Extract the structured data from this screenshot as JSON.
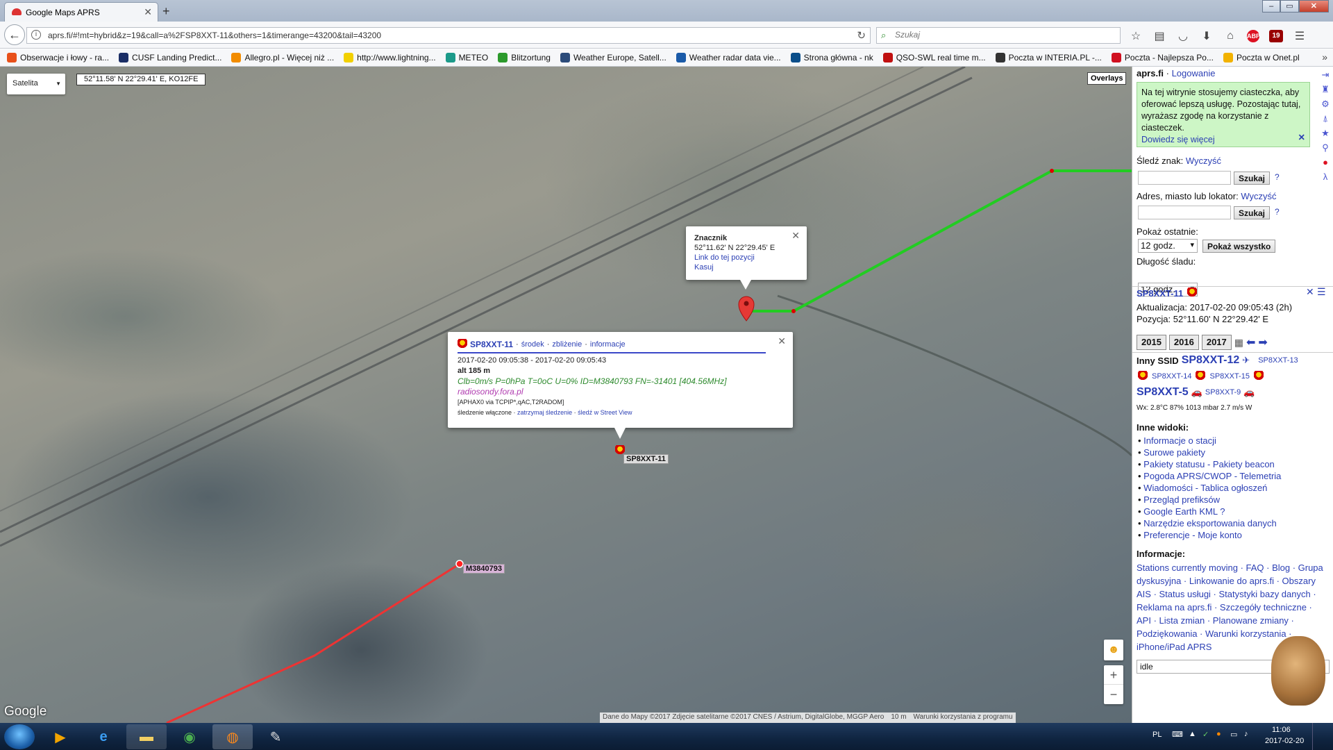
{
  "browser": {
    "tab_title": "Google Maps APRS",
    "url": "aprs.fi/#!mt=hybrid&z=19&call=a%2FSP8XXT-11&others=1&timerange=43200&tail=43200",
    "search_placeholder": "Szukaj",
    "toolbar_badge": "19",
    "abp_label": "ABP",
    "bookmarks": [
      {
        "label": "Obserwacje i łowy - ra...",
        "color": "#e8501a"
      },
      {
        "label": "CUSF Landing Predict...",
        "color": "#1a2e66"
      },
      {
        "label": "Allegro.pl - Więcej niż ...",
        "color": "#f28c00"
      },
      {
        "label": "http://www.lightning...",
        "color": "#f2d000"
      },
      {
        "label": "METEO",
        "color": "#1c9a8a"
      },
      {
        "label": "Blitzortung",
        "color": "#2c9a2c"
      },
      {
        "label": "Weather Europe, Satell...",
        "color": "#2b4b7a"
      },
      {
        "label": "Weather radar data vie...",
        "color": "#1a5aa8"
      },
      {
        "label": "Strona główna - nk",
        "color": "#0a4e8a"
      },
      {
        "label": "QSO-SWL real time m...",
        "color": "#c01010"
      },
      {
        "label": "Poczta w INTERIA.PL -...",
        "color": "#333333"
      },
      {
        "label": "Poczta - Najlepsza Po...",
        "color": "#d01020"
      },
      {
        "label": "Poczta w Onet.pl",
        "color": "#f2b200"
      }
    ]
  },
  "map": {
    "type_label": "Satelita",
    "cursor_coords": "52°11.58' N 22°29.41' E, KO12FE",
    "overlays_label": "Overlays",
    "google_logo": "Google",
    "attribution": "Dane do Mapy ©2017 Zdjęcie satelitarne ©2017 CNES / Astrium, DigitalGlobe, MGGP Aero",
    "scale": "10 m",
    "terms": "Warunki korzystania z programu",
    "labels": {
      "station": "SP8XXT-11",
      "sonde": "M3840793"
    },
    "marker_popup": {
      "title": "Znacznik",
      "coords": "52°11.62' N 22°29.45' E",
      "link": "Link do tej pozycji",
      "delete": "Kasuj"
    },
    "station_popup": {
      "callsign": "SP8XXT-11",
      "sep1": " · ",
      "center": "środek",
      "sep2": " · ",
      "zoom": "zbliżenie",
      "sep3": " · ",
      "info": "informacje",
      "time_range": "2017-02-20 09:05:38 - 2017-02-20 09:05:43",
      "altitude": "alt 185 m",
      "comment": "Clb=0m/s P=0hPa T=0oC U=0% ID=M3840793 FN=-31401 [404.56MHz]",
      "website": "radiosondy.fora.pl",
      "path": "[APHAX0 via TCPIP*,qAC,T2RADOM]",
      "tracking": "śledzenie włączone",
      "sep4": " · ",
      "stop_tracking": "zatrzymaj śledzenie",
      "sep5": " · ",
      "street_view": "śledź w Street View"
    }
  },
  "panel": {
    "site": "aprs.fi",
    "sep": " · ",
    "login": "Logowanie",
    "cookie_text": "Na tej witrynie stosujemy ciasteczka, aby oferować lepszą usługę. Pozostając tutaj, wyrażasz zgodę na korzystanie z ciasteczek.",
    "cookie_link": "Dowiedz się więcej",
    "track_label": "Śledź znak:",
    "clear": "Wyczyść",
    "address_label": "Adres, miasto lub lokator:",
    "search_btn": "Szukaj",
    "help": "?",
    "show_last_label": "Pokaż ostatnie:",
    "show_last_value": "12 godz.",
    "show_all_btn": "Pokaż wszystko",
    "trail_label": "Długość śladu:",
    "trail_value": "12 godz.",
    "station": {
      "callsign": "SP8XXT-11",
      "updated_label": "Aktualizacja:",
      "updated_value": "2017-02-20 09:05:43 (2h)",
      "position_label": "Pozycja:",
      "position_value": "52°11.60' N 22°29.42' E"
    },
    "years": [
      "2015",
      "2016",
      "2017"
    ],
    "other_ssid_label": "Inny SSID",
    "ssids": {
      "s12": "SP8XXT-12",
      "s13": "SP8XXT-13",
      "s14": "SP8XXT-14",
      "s15": "SP8XXT-15",
      "s5": "SP8XXT-5",
      "s9": "SP8XXT-9"
    },
    "weather": "Wx: 2.8°C 87% 1013 mbar 2.7 m/s W",
    "other_views_title": "Inne widoki:",
    "other_views": [
      "Informacje o stacji",
      "Surowe pakiety",
      "Pakiety statusu - Pakiety beacon",
      "Pogoda APRS/CWOP - Telemetria",
      "Wiadomości - Tablica ogłoszeń",
      "Przegląd prefiksów",
      "Google Earth KML ?",
      "Narzędzie eksportowania danych",
      "Preferencje - Moje konto"
    ],
    "info_title": "Informacje:",
    "info_links": "Stations currently moving · FAQ · Blog · Grupa dyskusyjna · Linkowanie do aprs.fi · Obszary AIS · Status usługi · Statystyki bazy danych · Reklama na aprs.fi · Szczegóły techniczne · API · Lista zmian · Planowane zmiany · Podziękowania · Warunki korzystania · iPhone/iPad APRS",
    "status_value": "idle"
  },
  "taskbar": {
    "lang": "PL",
    "time": "11:06",
    "date": "2017-02-20"
  }
}
